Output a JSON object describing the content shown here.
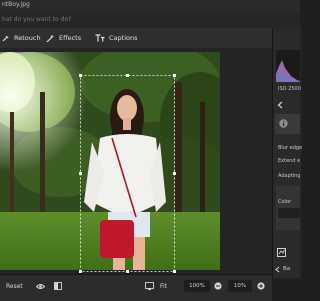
{
  "window": {
    "title": "ntBoy.jpg"
  },
  "search": {
    "placeholder": "hat do you want to do?"
  },
  "toolbar": {
    "tools": [
      {
        "label": "Retouch",
        "icon": "brush-icon"
      },
      {
        "label": "Effects",
        "icon": "magic-wand-icon"
      },
      {
        "label": "Captions",
        "icon": "text-icon"
      }
    ]
  },
  "panel": {
    "iso_label": "ISO 2500",
    "blur_edge_label": "Blur edge",
    "extend_label": "Extend e",
    "adapting_label": "Adapting",
    "color_label": "Color",
    "back_label": "Ba"
  },
  "bottombar": {
    "reset_label": "Reset",
    "fit_label": "Fit",
    "zoom_value": "100%",
    "zoom_step": "10%"
  },
  "colors": {
    "background": "#1f1f1f",
    "toolbar": "#2f2f2f",
    "accent": "#ffffff"
  }
}
